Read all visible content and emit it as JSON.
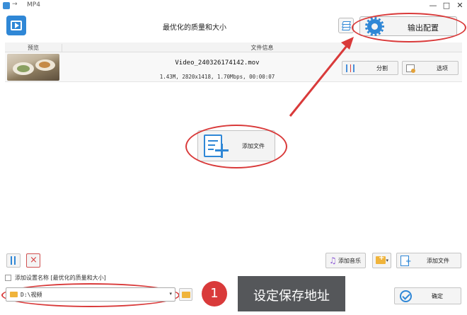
{
  "window": {
    "title": "MP4",
    "icon": "app-icon",
    "controls": [
      "minimize-icon",
      "maximize-icon",
      "close-icon"
    ],
    "control_glyphs": {
      "minimize": "—",
      "maximize": "□",
      "close": "✕"
    }
  },
  "toolbar": {
    "profile_title": "最优化的质量和大小",
    "output_config_label": "输出配置"
  },
  "file_list": {
    "columns": {
      "preview": "预览",
      "info": "文件信息"
    },
    "rows": [
      {
        "name": "Video_240326174142.mov",
        "meta": "1.43M, 2820x1418, 1.70Mbps, 00:00:07",
        "split_label": "分割",
        "options_label": "选项"
      }
    ]
  },
  "center": {
    "add_files_label": "添加文件"
  },
  "bottom": {
    "add_music_label": "添加音乐",
    "add_files_label": "添加文件",
    "checkbox_label": "添加设置名称 [最优化的质量和大小]",
    "checkbox_checked": false,
    "save_path": "D:\\视频",
    "ok_label": "确定"
  },
  "annotation": {
    "step_number": "1",
    "callout_text": "设定保存地址",
    "color": "#d93a3a"
  },
  "colors": {
    "accent": "#2f87d6",
    "annotation": "#d93a3a",
    "callout_bg": "#55575a"
  }
}
